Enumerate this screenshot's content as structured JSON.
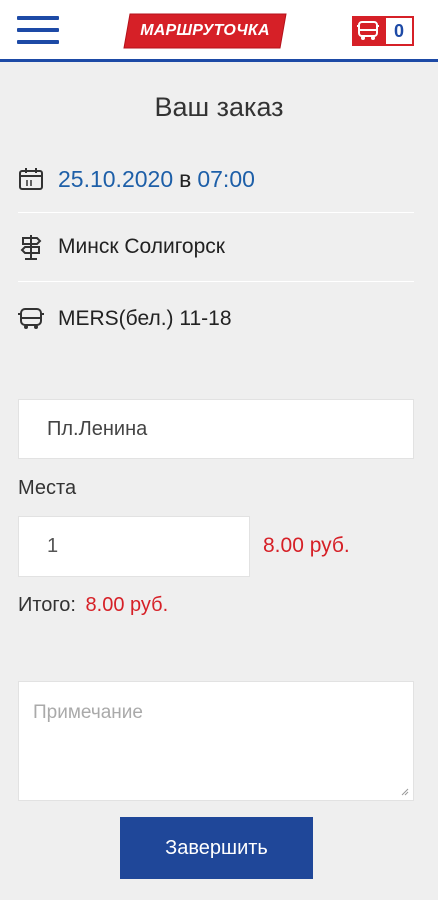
{
  "header": {
    "menu_icon": "hamburger-icon",
    "logo_text": "МАРШРУТОЧКА",
    "cart_icon": "bus-icon",
    "cart_count": "0",
    "accent_color": "#1d4aa6",
    "brand_red": "#d62027"
  },
  "order": {
    "title": "Ваш заказ",
    "date": "25.10.2020",
    "date_connector": "в",
    "time": "07:00",
    "route": "Минск Солигорск",
    "vehicle": "MERS(бел.) 11-18"
  },
  "form": {
    "stop_value": "Пл.Ленина",
    "seats_label": "Места",
    "seats_value": "1",
    "seat_price": "8.00 руб.",
    "total_label": "Итого:",
    "total_value": "8.00 руб.",
    "note_placeholder": "Примечание",
    "submit_label": "Завершить"
  }
}
